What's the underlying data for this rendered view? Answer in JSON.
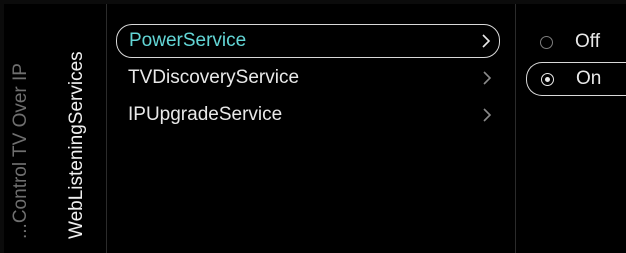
{
  "breadcrumb": {
    "label": "...Control TV Over IP"
  },
  "section": {
    "title": "WebListeningServices"
  },
  "menu": {
    "items": [
      {
        "label": "PowerService",
        "selected": true
      },
      {
        "label": "TVDiscoveryService",
        "selected": false
      },
      {
        "label": "IPUpgradeService",
        "selected": false
      }
    ]
  },
  "options": {
    "items": [
      {
        "label": "Off",
        "selected": false
      },
      {
        "label": "On",
        "selected": true
      }
    ]
  },
  "colors": {
    "background": "#000000",
    "highlight_text": "#63d6d6",
    "focus_border": "#d8d8d8"
  }
}
